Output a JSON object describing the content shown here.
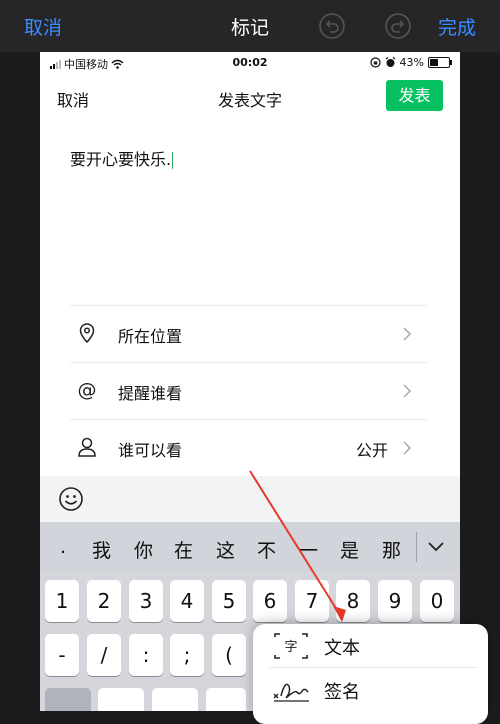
{
  "editor": {
    "cancel_label": "取消",
    "title": "标记",
    "done_label": "完成"
  },
  "status_bar": {
    "carrier": "中国移动",
    "time": "00:02",
    "battery": "43%",
    "battery_level": 0.43
  },
  "compose": {
    "cancel_label": "取消",
    "title": "发表文字",
    "publish_label": "发表",
    "text": "要开心要快乐."
  },
  "options": [
    {
      "icon": "location-pin-icon",
      "label": "所在位置",
      "value": ""
    },
    {
      "icon": "at-mention-icon",
      "label": "提醒谁看",
      "value": ""
    },
    {
      "icon": "person-icon",
      "label": "谁可以看",
      "value": "公开"
    }
  ],
  "keyboard": {
    "candidates": [
      ".",
      "我",
      "你",
      "在",
      "这",
      "不",
      "一",
      "是",
      "那"
    ],
    "row1": [
      "1",
      "2",
      "3",
      "4",
      "5",
      "6",
      "7",
      "8",
      "9",
      "0"
    ],
    "row2": [
      "-",
      "/",
      ":",
      ";",
      "(",
      "",
      ""
    ]
  },
  "popup_menu": {
    "items": [
      {
        "icon": "text-box-icon",
        "label": "文本"
      },
      {
        "icon": "signature-icon",
        "label": "签名"
      }
    ]
  },
  "colors": {
    "accent_blue": "#3a8cff",
    "publish_green": "#07c160",
    "annotation_arrow": "#e8392b"
  }
}
